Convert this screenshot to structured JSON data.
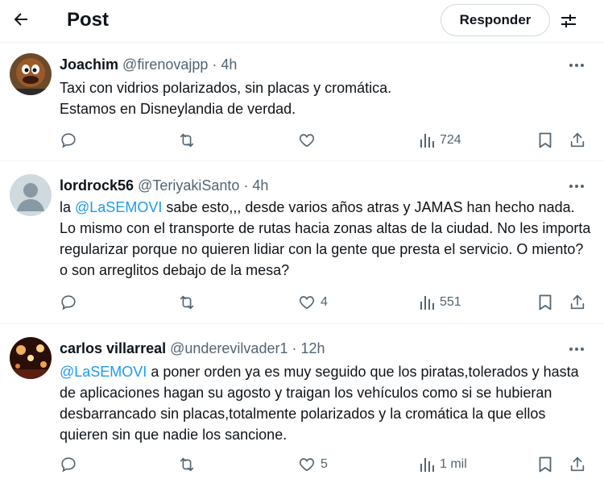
{
  "header": {
    "title": "Post",
    "reply_button": "Responder",
    "back_icon": "arrow-left-icon",
    "settings_icon": "sliders-icon"
  },
  "colors": {
    "text": "#0f1419",
    "secondary": "#536471",
    "link": "#1d9bf0",
    "divider": "#eff3f4"
  },
  "replies": [
    {
      "name": "Joachim",
      "handle": "@firenovajpp",
      "dot": "·",
      "time": "4h",
      "text_parts": [
        {
          "type": "text",
          "value": "Taxi con vidrios polarizados, sin placas y cromática."
        },
        {
          "type": "text",
          "value": "Estamos en Disneylandia de verdad."
        }
      ],
      "replies_count": "",
      "reposts_count": "",
      "likes_count": "",
      "views_count": "724"
    },
    {
      "name": "lordrock56",
      "handle": "@TeriyakiSanto",
      "dot": "·",
      "time": "4h",
      "text_parts": [
        {
          "type": "text",
          "value": "la "
        },
        {
          "type": "mention",
          "value": "@LaSEMOVI"
        },
        {
          "type": "text",
          "value": " sabe esto,,, desde varios años atras y JAMAS han hecho nada. Lo mismo con el transporte de rutas hacia zonas altas de la ciudad. No les importa regularizar porque no quieren lidiar con la gente que presta el servicio. O miento? o son arreglitos debajo de la mesa?"
        }
      ],
      "replies_count": "",
      "reposts_count": "",
      "likes_count": "4",
      "views_count": "551"
    },
    {
      "name": "carlos villarreal",
      "handle": "@underevilvader1",
      "dot": "·",
      "time": "12h",
      "text_parts": [
        {
          "type": "mention",
          "value": "@LaSEMOVI"
        },
        {
          "type": "text",
          "value": " a poner orden ya es muy seguido que los piratas,tolerados y hasta de aplicaciones hagan su agosto y traigan los vehículos como si se hubieran desbarrancado sin placas,totalmente polarizados y la cromática la que ellos quieren sin que nadie los sancione."
        }
      ],
      "replies_count": "",
      "reposts_count": "",
      "likes_count": "5",
      "views_count": "1 mil"
    }
  ]
}
